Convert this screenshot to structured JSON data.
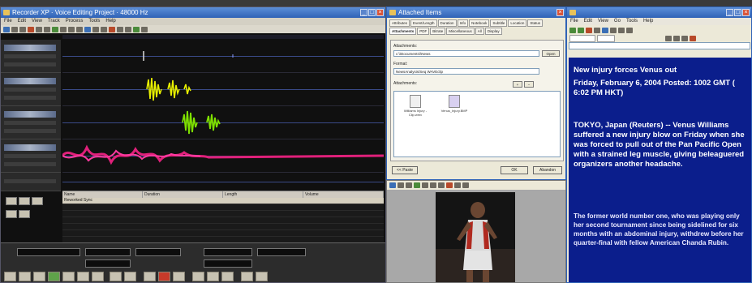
{
  "editor": {
    "title": "Recorder XP · Voice Editing Project · 48000 Hz",
    "menu": [
      "File",
      "Edit",
      "View",
      "Track",
      "Process",
      "Tools",
      "Help"
    ],
    "event_list": {
      "headers": [
        "Name",
        "Duration",
        "Length",
        "Volume"
      ],
      "rows": [
        "Reworked Sync",
        "",
        "",
        "",
        "",
        ""
      ]
    }
  },
  "dialog": {
    "title": "Attached Items",
    "tabs": [
      "Attributes",
      "Event/Length",
      "Duration",
      "Info",
      "Notebook",
      "Subtitle",
      "Location",
      "Status",
      "Attachments",
      "PDF",
      "Bitrate",
      "Miscellaneous",
      "All",
      "Display"
    ],
    "active_tab": "Attachments",
    "fields": {
      "label1": "Attachments:",
      "value1": "c:\\\\Documents\\\\News",
      "label2": "Format:",
      "value2": "NewsAnalysis/Seq WAVEclip",
      "label3": "Attachments:"
    },
    "browse_label": "Open",
    "attachments": [
      "Williams Injury - Clip.wmv",
      "Venus_Injury.BMP"
    ],
    "buttons": {
      "add": "<< Paste",
      "ok": "OK",
      "cancel": "Abandon"
    }
  },
  "browser": {
    "menu": [
      "File",
      "Edit",
      "View",
      "Go",
      "Tools",
      "Help"
    ],
    "article": {
      "headline": "New injury forces Venus out",
      "dateline": "Friday, February 6, 2004 Posted: 1002 GMT ( 6:02 PM HKT)",
      "para1": "TOKYO, Japan (Reuters) -- Venus Williams suffered a new injury blow on Friday when she was forced to pull out of the Pan Pacific Open with a strained leg muscle, giving beleaguered organizers another headache.",
      "para2": "The former world number one, who was playing only her second tournament since being sidelined for six months with an abdominal injury, withdrew before her quarter-final with fellow American Chanda Rubin."
    }
  }
}
